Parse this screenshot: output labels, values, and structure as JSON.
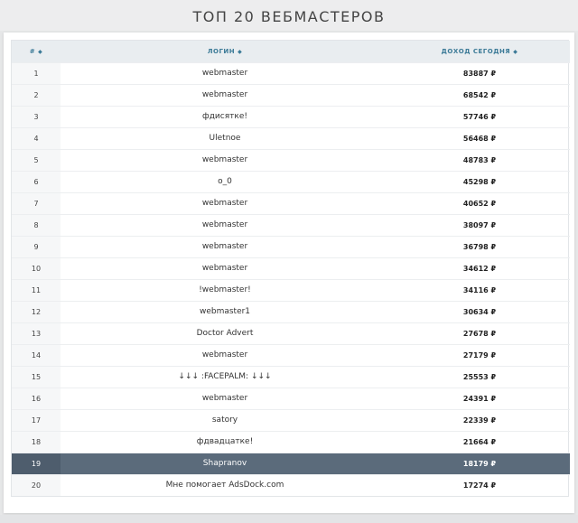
{
  "title": "ТОП 20 ВЕБМАСТЕРОВ",
  "table": {
    "columns": [
      "#",
      "ЛОГИН",
      "ДОХОД СЕГОДНЯ"
    ],
    "highlight_rank": "19",
    "rows": [
      {
        "rank": "1",
        "login": "webmaster",
        "income": "83887 ₽"
      },
      {
        "rank": "2",
        "login": "webmaster",
        "income": "68542 ₽"
      },
      {
        "rank": "3",
        "login": "фдисятке!",
        "income": "57746 ₽"
      },
      {
        "rank": "4",
        "login": "Uletnoe",
        "income": "56468 ₽"
      },
      {
        "rank": "5",
        "login": "webmaster",
        "income": "48783 ₽"
      },
      {
        "rank": "6",
        "login": "o_0",
        "income": "45298 ₽"
      },
      {
        "rank": "7",
        "login": "webmaster",
        "income": "40652 ₽"
      },
      {
        "rank": "8",
        "login": "webmaster",
        "income": "38097 ₽"
      },
      {
        "rank": "9",
        "login": "webmaster",
        "income": "36798 ₽"
      },
      {
        "rank": "10",
        "login": "webmaster",
        "income": "34612 ₽"
      },
      {
        "rank": "11",
        "login": "!webmaster!",
        "income": "34116 ₽"
      },
      {
        "rank": "12",
        "login": "webmaster1",
        "income": "30634 ₽"
      },
      {
        "rank": "13",
        "login": "Doctor Advert",
        "income": "27678 ₽"
      },
      {
        "rank": "14",
        "login": "webmaster",
        "income": "27179 ₽"
      },
      {
        "rank": "15",
        "login": "↓↓↓ :FACEPALM: ↓↓↓",
        "income": "25553 ₽"
      },
      {
        "rank": "16",
        "login": "webmaster",
        "income": "24391 ₽"
      },
      {
        "rank": "17",
        "login": "satory",
        "income": "22339 ₽"
      },
      {
        "rank": "18",
        "login": "фдвадцатке!",
        "income": "21664 ₽"
      },
      {
        "rank": "19",
        "login": "Shapranov",
        "income": "18179 ₽"
      },
      {
        "rank": "20",
        "login": "Мне помогает AdsDock.com",
        "income": "17274 ₽"
      }
    ]
  }
}
